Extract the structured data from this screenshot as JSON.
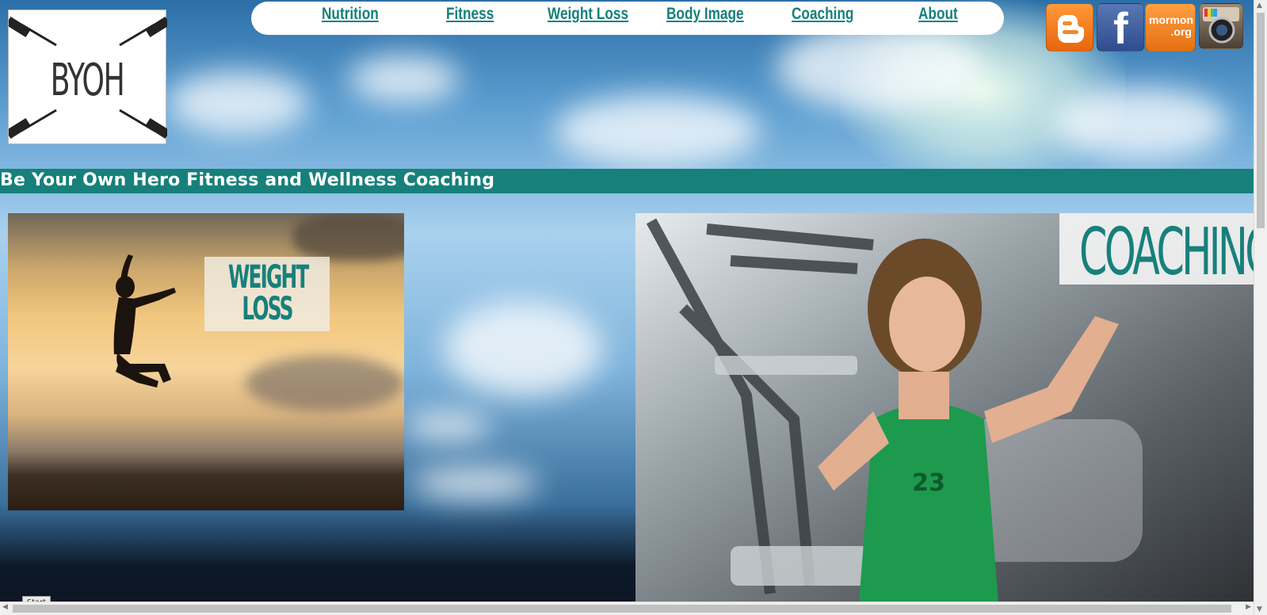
{
  "site": {
    "logo_text": "BYOH",
    "tagline": "Be Your Own Hero Fitness and Wellness Coaching",
    "accent_color": "#17807b"
  },
  "nav": {
    "items": [
      {
        "label": "Nutrition"
      },
      {
        "label": "Fitness"
      },
      {
        "label": "Weight Loss"
      },
      {
        "label": "Body Image"
      },
      {
        "label": "Coaching"
      },
      {
        "label": "About"
      }
    ]
  },
  "social": {
    "blogger": {
      "icon": "blogger-icon"
    },
    "facebook": {
      "icon": "facebook-icon",
      "letter": "f"
    },
    "mormon": {
      "icon": "mormon-org-icon",
      "line1": "mormon",
      "line2": ".org"
    },
    "instagram": {
      "icon": "instagram-icon"
    }
  },
  "cards": {
    "weight_loss": {
      "line1": "WEIGHT",
      "line2": "LOSS"
    },
    "coaching": {
      "label": "COACHING"
    }
  },
  "taskbar": {
    "start_label": "Start"
  }
}
